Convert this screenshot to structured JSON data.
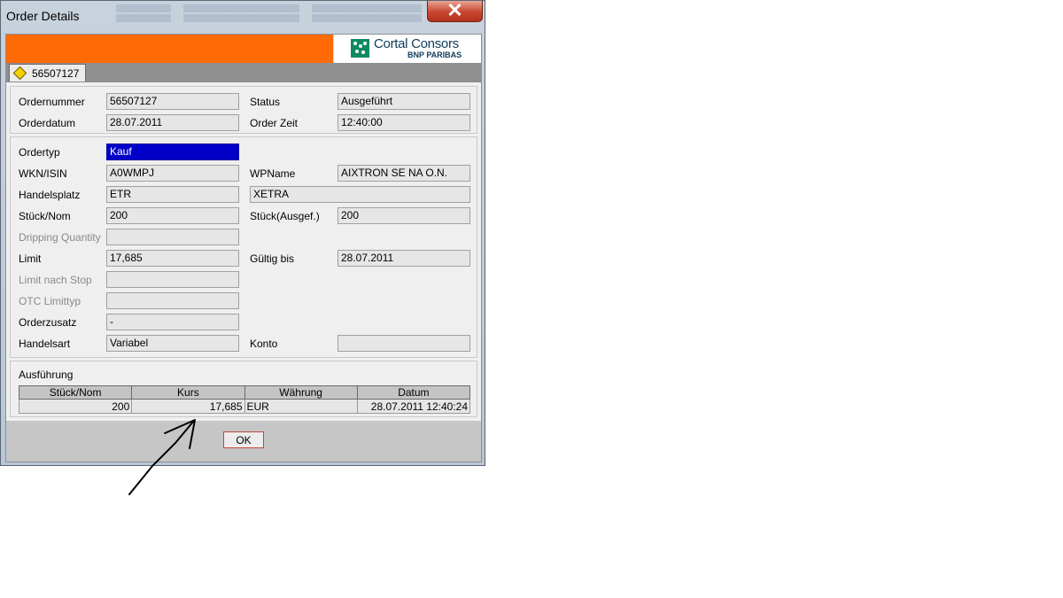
{
  "window": {
    "title": "Order Details",
    "close_glyph": "✕"
  },
  "brand": {
    "name": "Cortal Consors",
    "sub": "BNP PARIBAS",
    "orange": "#ff6a06",
    "green": "#0f8a5f"
  },
  "tab": {
    "label": "56507127",
    "icon": "diamond-icon"
  },
  "header": {
    "ordernummer_label": "Ordernummer",
    "ordernummer": "56507127",
    "status_label": "Status",
    "status": "Ausgeführt",
    "orderdatum_label": "Orderdatum",
    "orderdatum": "28.07.2011",
    "orderzeit_label": "Order Zeit",
    "orderzeit": "12:40:00"
  },
  "details": {
    "ordertyp_label": "Ordertyp",
    "ordertyp": "Kauf",
    "wkn_label": "WKN/ISIN",
    "wkn": "A0WMPJ",
    "wpname_label": "WPName",
    "wpname": "AIXTRON SE NA O.N.",
    "handelsplatz_label": "Handelsplatz",
    "handelsplatz": "ETR",
    "handelsplatz_name": "XETRA",
    "stueck_label": "Stück/Nom",
    "stueck": "200",
    "stueck_ausgef_label": "Stück(Ausgef.)",
    "stueck_ausgef": "200",
    "dripping_label": "Dripping Quantity",
    "dripping": "",
    "limit_label": "Limit",
    "limit": "17,685",
    "gueltig_label": "Gültig bis",
    "gueltig": "28.07.2011",
    "limit_stop_label": "Limit nach Stop",
    "limit_stop": "",
    "otc_label": "OTC Limittyp",
    "otc": "",
    "orderzusatz_label": "Orderzusatz",
    "orderzusatz": "-",
    "handelsart_label": "Handelsart",
    "handelsart": "Variabel",
    "konto_label": "Konto",
    "konto": ""
  },
  "execution": {
    "section_label": "Ausführung",
    "columns": [
      "Stück/Nom",
      "Kurs",
      "Währung",
      "Datum"
    ],
    "rows": [
      [
        "200",
        "17,685",
        "EUR",
        "28.07.2011 12:40:24"
      ]
    ]
  },
  "footer": {
    "ok_label": "OK"
  }
}
